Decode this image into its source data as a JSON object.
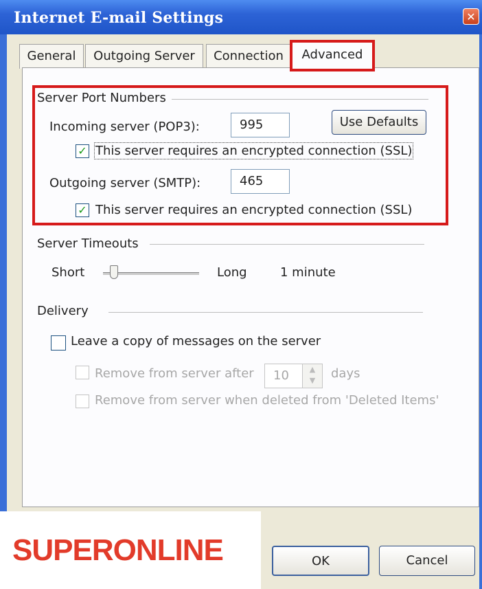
{
  "window": {
    "title": "Internet E-mail Settings",
    "close_glyph": "✕"
  },
  "tabs": [
    {
      "label": "General"
    },
    {
      "label": "Outgoing Server"
    },
    {
      "label": "Connection"
    },
    {
      "label": "Advanced",
      "active": true
    }
  ],
  "server_ports": {
    "group_label": "Server Port Numbers",
    "incoming_label": "Incoming server (POP3):",
    "incoming_value": "995",
    "use_defaults_label": "Use Defaults",
    "incoming_ssl_label": "This server requires an encrypted connection (SSL)",
    "incoming_ssl_checked": true,
    "outgoing_label": "Outgoing server (SMTP):",
    "outgoing_value": "465",
    "outgoing_ssl_label": "This server requires an encrypted connection (SSL)",
    "outgoing_ssl_checked": true,
    "check_glyph": "✓"
  },
  "timeouts": {
    "group_label": "Server Timeouts",
    "short_label": "Short",
    "long_label": "Long",
    "value_text": "1 minute",
    "slider_level": 0.1
  },
  "delivery": {
    "group_label": "Delivery",
    "leave_copy_label": "Leave a copy of messages on the server",
    "leave_copy_checked": false,
    "remove_after_label": "Remove from server after",
    "remove_after_days": "10",
    "days_label": "days",
    "remove_deleted_label": "Remove from server when deleted from 'Deleted Items'",
    "spin_up_glyph": "▲",
    "spin_down_glyph": "▼"
  },
  "footer": {
    "ok_label": "OK",
    "cancel_label": "Cancel"
  },
  "watermark": {
    "text": "SUPERONLINE"
  },
  "colors": {
    "highlight_red": "#d61a1a",
    "titlebar_blue": "#2d63d6",
    "logo_red": "#e23b2a"
  }
}
